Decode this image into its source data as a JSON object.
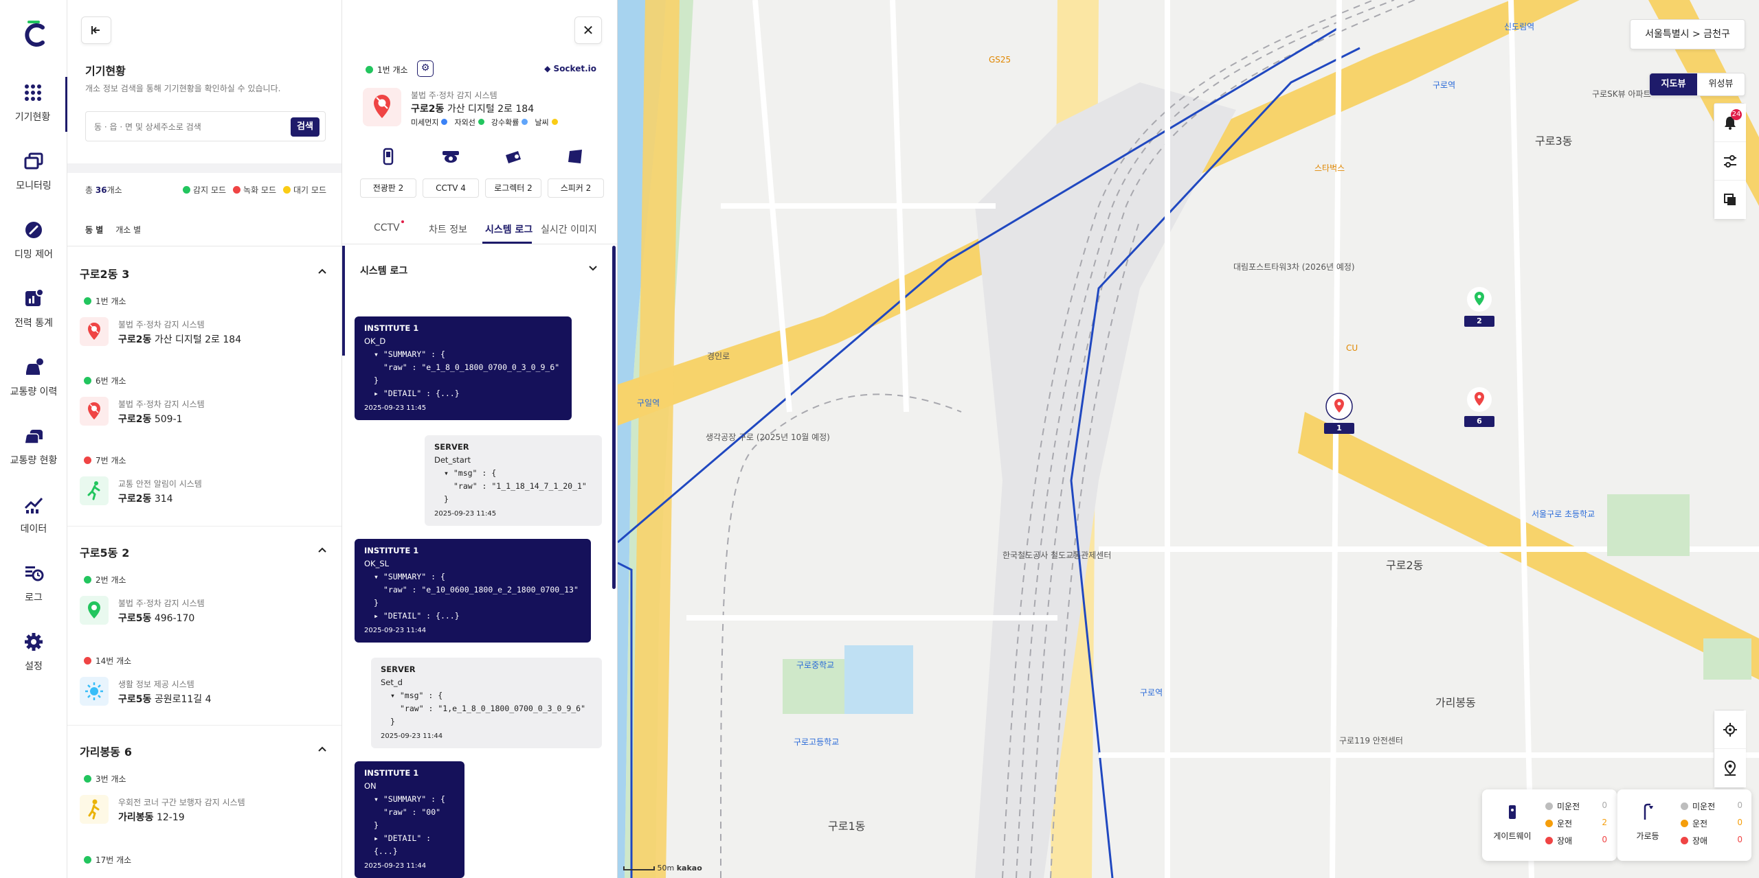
{
  "nav": {
    "items": [
      {
        "label": "기기현황",
        "icon": "grid-dots-icon"
      },
      {
        "label": "모니터링",
        "icon": "monitor-icon"
      },
      {
        "label": "디밍 제어",
        "icon": "dimming-icon"
      },
      {
        "label": "전력 통계",
        "icon": "power-stats-icon"
      },
      {
        "label": "교통량 이력",
        "icon": "traffic-history-icon"
      },
      {
        "label": "교통량 현황",
        "icon": "traffic-status-icon"
      },
      {
        "label": "데이터",
        "icon": "data-chart-icon"
      },
      {
        "label": "로그",
        "icon": "log-icon"
      },
      {
        "label": "설정",
        "icon": "settings-icon"
      }
    ]
  },
  "list": {
    "title": "기기현황",
    "subtitle": "개소 정보 검색을 통해 기기현황을 확인하실 수 있습니다.",
    "search_placeholder": "동 · 읍 · 면 및 상세주소로 검색",
    "search_button": "검색",
    "total_prefix": "총 ",
    "total_count": "36",
    "total_suffix": "개소",
    "legend": [
      {
        "label": "감지 모드",
        "color": "#22c55e"
      },
      {
        "label": "녹화 모드",
        "color": "#ef4444"
      },
      {
        "label": "대기 모드",
        "color": "#facc15"
      }
    ],
    "view_tabs": [
      "동 별",
      "개소 별"
    ],
    "groups": [
      {
        "name": "구로2동",
        "count": "3",
        "devices": [
          {
            "badge": "1번 개소",
            "status_color": "#22c55e",
            "system": "불법 주·정차 감지 시스템",
            "dong": "구로2동",
            "addr": "가산 디지털 2로 184",
            "icon_bg": "#fdecec",
            "icon_color": "#ef4444"
          },
          {
            "badge": "6번 개소",
            "status_color": "#22c55e",
            "system": "불법 주·정차 감지 시스템",
            "dong": "구로2동",
            "addr": "509-1",
            "icon_bg": "#fdecec",
            "icon_color": "#ef4444"
          },
          {
            "badge": "7번 개소",
            "status_color": "#ef4444",
            "system": "교통 안전 알림이 시스템",
            "dong": "구로2동",
            "addr": "314",
            "icon_bg": "#e9f9ef",
            "icon_color": "#22c55e"
          }
        ]
      },
      {
        "name": "구로5동",
        "count": "2",
        "devices": [
          {
            "badge": "2번 개소",
            "status_color": "#22c55e",
            "system": "불법 주·정차 감지 시스템",
            "dong": "구로5동",
            "addr": "496-170",
            "icon_bg": "#e9f9ef",
            "icon_color": "#22c55e"
          },
          {
            "badge": "14번 개소",
            "status_color": "#ef4444",
            "system": "생활 정보 제공 시스템",
            "dong": "구로5동",
            "addr": "공원로11길 4",
            "icon_bg": "#e8f4fd",
            "icon_color": "#38bdf8"
          }
        ]
      },
      {
        "name": "가리봉동",
        "count": "6",
        "devices": [
          {
            "badge": "3번 개소",
            "status_color": "#22c55e",
            "system": "우회전 코너 구간 보행자 감지 시스템",
            "dong": "가리봉동",
            "addr": "12-19",
            "icon_bg": "#fef9e6",
            "icon_color": "#eab308"
          },
          {
            "badge": "17번 개소",
            "status_color": "#22c55e",
            "system": "",
            "dong": "",
            "addr": "",
            "icon_bg": "#fff",
            "icon_color": "#fff"
          }
        ]
      }
    ]
  },
  "detail": {
    "status_label": "1번 개소",
    "socket_label": "Socket.io",
    "system": "불법 주·정차 감지 시스템",
    "dong": "구로2동",
    "addr": "가산 디지털 2로 184",
    "sensors": [
      {
        "label": "미세먼지",
        "color": "#3b82f6"
      },
      {
        "label": "자외선",
        "color": "#22c55e"
      },
      {
        "label": "강수확률",
        "color": "#60a5fa"
      },
      {
        "label": "날씨",
        "color": "#facc15"
      }
    ],
    "equipment": [
      {
        "label": "전광판 2",
        "icon": "signboard-icon"
      },
      {
        "label": "CCTV 4",
        "icon": "cctv-icon"
      },
      {
        "label": "로그렉터 2",
        "icon": "collector-icon"
      },
      {
        "label": "스피커 2",
        "icon": "speaker-icon"
      }
    ],
    "tabs": [
      "CCTV",
      "차트 정보",
      "시스템 로그",
      "실시간 이미지"
    ],
    "active_tab": "시스템 로그",
    "log_title": "시스템 로그",
    "logs": [
      {
        "kind": "inst",
        "src": "INSTITUTE 1",
        "code": "OK_D",
        "k1": "\"SUMMARY\" : {",
        "k2": "\"raw\" : \"e_1_8_0_1800_0700_0_3_0_9_6\"",
        "close": "}",
        "k3": "\"DETAIL\" : {...}",
        "ts": "2025-09-23 11:45"
      },
      {
        "kind": "srv",
        "src": "SERVER",
        "code": "Det_start",
        "k1": "\"msg\" : {",
        "k2": "\"raw\" : \"1_1_18_14_7_1_20_1\"",
        "close": "}",
        "ts": "2025-09-23 11:45"
      },
      {
        "kind": "inst",
        "src": "INSTITUTE 1",
        "code": "OK_SL",
        "k1": "\"SUMMARY\" : {",
        "k2": "\"raw\" : \"e_10_0600_1800_e_2_1800_0700_13\"",
        "close": "}",
        "k3": "\"DETAIL\" : {...}",
        "ts": "2025-09-23 11:44"
      },
      {
        "kind": "srv",
        "src": "SERVER",
        "code": "Set_d",
        "k1": "\"msg\" : {",
        "k2": "\"raw\" : \"1,e_1_8_0_1800_0700_0_3_0_9_6\"",
        "close": "}",
        "ts": "2025-09-23 11:44"
      },
      {
        "kind": "inst",
        "src": "INSTITUTE 1",
        "code": "ON",
        "k1": "\"SUMMARY\" : {",
        "k2": "\"raw\" : \"00\"",
        "close": "}",
        "k3": "\"DETAIL\" : {...}",
        "ts": "2025-09-23 11:44"
      }
    ]
  },
  "map": {
    "region": "서울특별시 > 금천구",
    "map_types": [
      "지도뷰",
      "위성뷰"
    ],
    "notification_count": "24",
    "markers": [
      {
        "num": "1",
        "color": "#ef4444"
      },
      {
        "num": "2",
        "color": "#22c55e"
      },
      {
        "num": "6",
        "color": "#ef4444"
      }
    ],
    "labels": [
      {
        "text": "구로2동",
        "cls": "big"
      },
      {
        "text": "구로1동",
        "cls": "big"
      },
      {
        "text": "구로3동",
        "cls": "big"
      },
      {
        "text": "신도림역",
        "cls": "b"
      },
      {
        "text": "구로역",
        "cls": "b"
      },
      {
        "text": "대림포스트타워3차 (2026년 예정)",
        "cls": ""
      },
      {
        "text": "생각공장 구로 (2025년 10월 예정)",
        "cls": ""
      },
      {
        "text": "구로중학교",
        "cls": "b"
      },
      {
        "text": "한국철도공사 철도교통관제센터",
        "cls": ""
      },
      {
        "text": "구로고등학교",
        "cls": "b"
      },
      {
        "text": "구로SK뷰 아파트",
        "cls": ""
      },
      {
        "text": "구로119 안전센터",
        "cls": ""
      },
      {
        "text": "서울구로 초등학교",
        "cls": "b"
      },
      {
        "text": "GS25",
        "cls": "o"
      },
      {
        "text": "CU",
        "cls": "o"
      },
      {
        "text": "스타벅스",
        "cls": "o"
      },
      {
        "text": "구로역",
        "cls": "b"
      },
      {
        "text": "경인로",
        "cls": ""
      },
      {
        "text": "구일역",
        "cls": "b"
      },
      {
        "text": "가리봉동",
        "cls": "big"
      }
    ],
    "status_cards": [
      {
        "title": "게이트웨이",
        "icon": "gateway-icon",
        "rows": [
          {
            "label": "미운전",
            "value": "0",
            "color": "#bdbdbd"
          },
          {
            "label": "운전",
            "value": "2",
            "color": "#f59e0b"
          },
          {
            "label": "장애",
            "value": "0",
            "color": "#ef4444"
          }
        ]
      },
      {
        "title": "가로등",
        "icon": "streetlight-icon",
        "rows": [
          {
            "label": "미운전",
            "value": "0",
            "color": "#bdbdbd"
          },
          {
            "label": "운전",
            "value": "0",
            "color": "#f59e0b"
          },
          {
            "label": "장애",
            "value": "0",
            "color": "#ef4444"
          }
        ]
      }
    ],
    "scale": "50m",
    "provider": "kakao"
  }
}
